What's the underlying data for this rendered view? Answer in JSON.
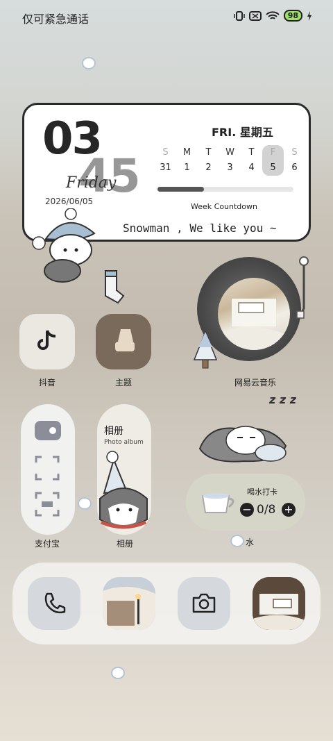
{
  "status": {
    "carrier": "仅可紧急通话",
    "battery": "98"
  },
  "calendar": {
    "hour": "03",
    "minute": "45",
    "weekday_script": "Friday",
    "date": "2026/06/05",
    "day_label": "FRI. 星期五",
    "week_letters": [
      "S",
      "M",
      "T",
      "W",
      "T",
      "F",
      "S"
    ],
    "week_numbers": [
      "31",
      "1",
      "2",
      "3",
      "4",
      "5",
      "6"
    ],
    "selected_index": 5,
    "progress": 0.34,
    "countdown_label": "Week Countdown",
    "tagline": "Snowman , We like you ~"
  },
  "apps": {
    "douyin": "抖音",
    "theme": "主题",
    "netease": "网易云音乐",
    "alipay": "支付宝",
    "album_title": "相册",
    "album_sub": "Photo album",
    "album_label": "相册",
    "water_title": "喝水打卡",
    "water_count": "0/8",
    "water_label": "水"
  },
  "sleep_text": "z z z",
  "colors": {
    "accent": "#9ee06a",
    "ink": "#222222"
  }
}
